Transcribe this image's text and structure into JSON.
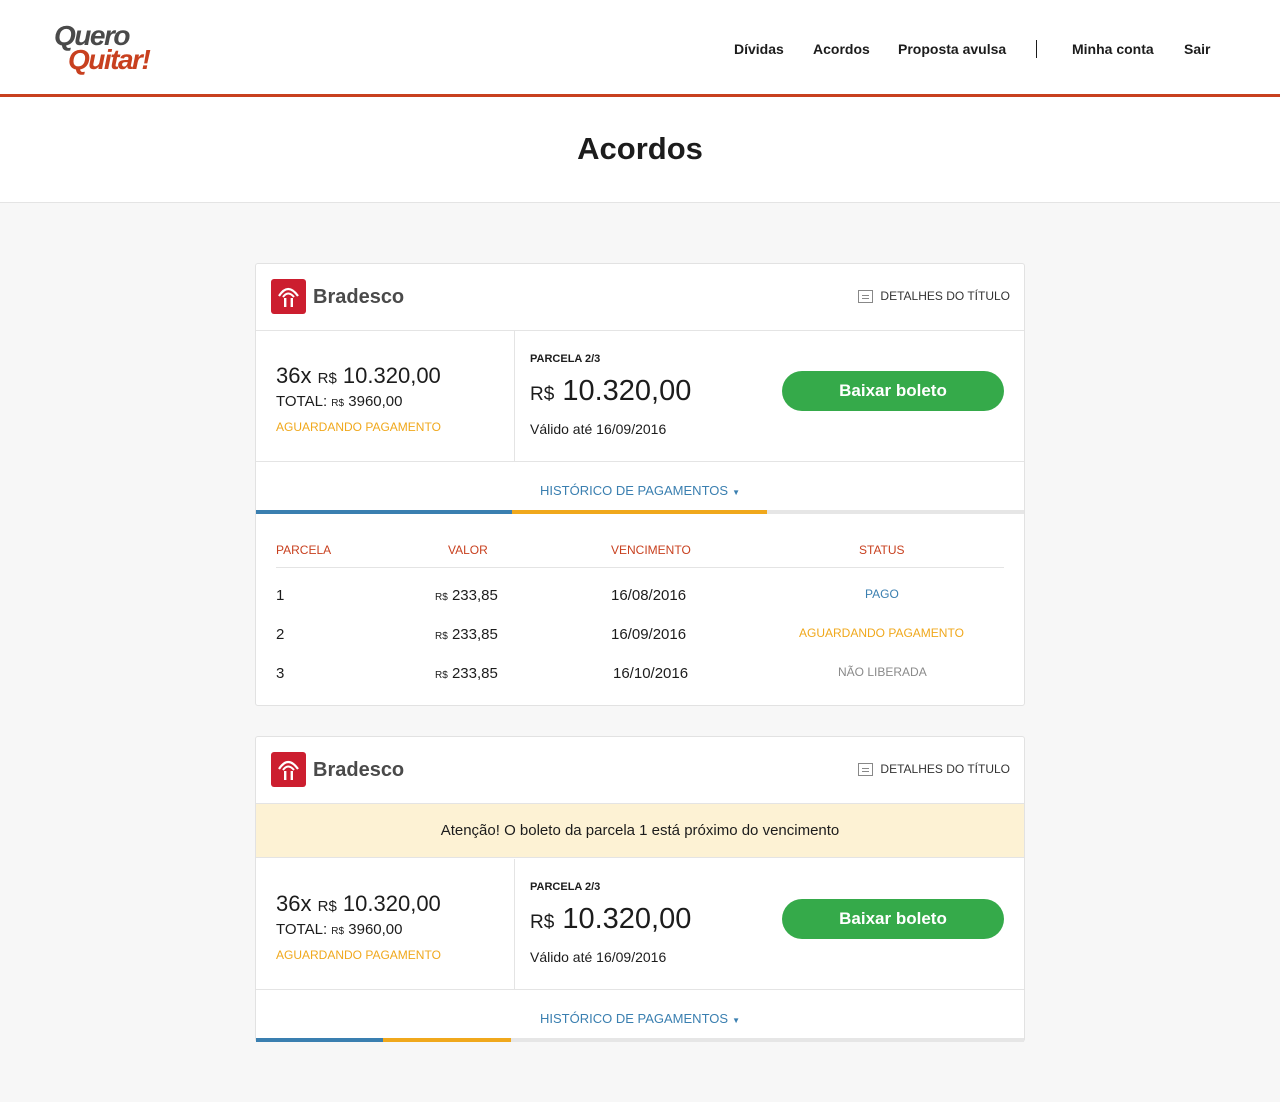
{
  "brand": {
    "logo_line1": "Quero",
    "logo_line2": "Quitar!",
    "accent": "#c8401f"
  },
  "nav": {
    "dividas": "Dívidas",
    "acordos": "Acordos",
    "proposta": "Proposta avulsa",
    "conta": "Minha conta",
    "sair": "Sair"
  },
  "page_title": "Acordos",
  "cards": [
    {
      "bank": "Bradesco",
      "details_label": "DETALHES DO TÍTULO",
      "installments_prefix": "36x",
      "currency": "R$",
      "installment_amount": "10.320,00",
      "total_label": "TOTAL:",
      "total_amount": "3960,00",
      "status": "AGUARDANDO PAGAMENTO",
      "parcela_label": "PARCELA 2/3",
      "parcela_amount": "10.320,00",
      "valid_until": "Válido até 16/09/2016",
      "button": "Baixar boleto",
      "history_label": "HISTÓRICO DE PAGAMENTOS",
      "table": {
        "headers": [
          "PARCELA",
          "VALOR",
          "VENCIMENTO",
          "STATUS"
        ],
        "rows": [
          {
            "parcela": "1",
            "valor": "233,85",
            "vencimento": "16/08/2016",
            "status": "PAGO"
          },
          {
            "parcela": "2",
            "valor": "233,85",
            "vencimento": "16/09/2016",
            "status": "AGUARDANDO PAGAMENTO"
          },
          {
            "parcela": "3",
            "valor": "233,85",
            "vencimento": "16/10/2016",
            "status": "NÃO LIBERADA"
          }
        ]
      }
    },
    {
      "bank": "Bradesco",
      "details_label": "DETALHES DO TÍTULO",
      "alert": "Atenção! O boleto da parcela 1 está próximo do vencimento",
      "installments_prefix": "36x",
      "currency": "R$",
      "installment_amount": "10.320,00",
      "total_label": "TOTAL:",
      "total_amount": "3960,00",
      "status": "AGUARDANDO PAGAMENTO",
      "parcela_label": "PARCELA 2/3",
      "parcela_amount": "10.320,00",
      "valid_until": "Válido até 16/09/2016",
      "button": "Baixar boleto",
      "history_label": "HISTÓRICO DE PAGAMENTOS"
    }
  ],
  "colors": {
    "paid": "#3a7fb0",
    "waiting": "#f0a81c",
    "locked": "#8a8a8a",
    "button": "#35aa4a",
    "alert_bg": "#fdf2d4",
    "bank_red": "#cc1e2f"
  }
}
